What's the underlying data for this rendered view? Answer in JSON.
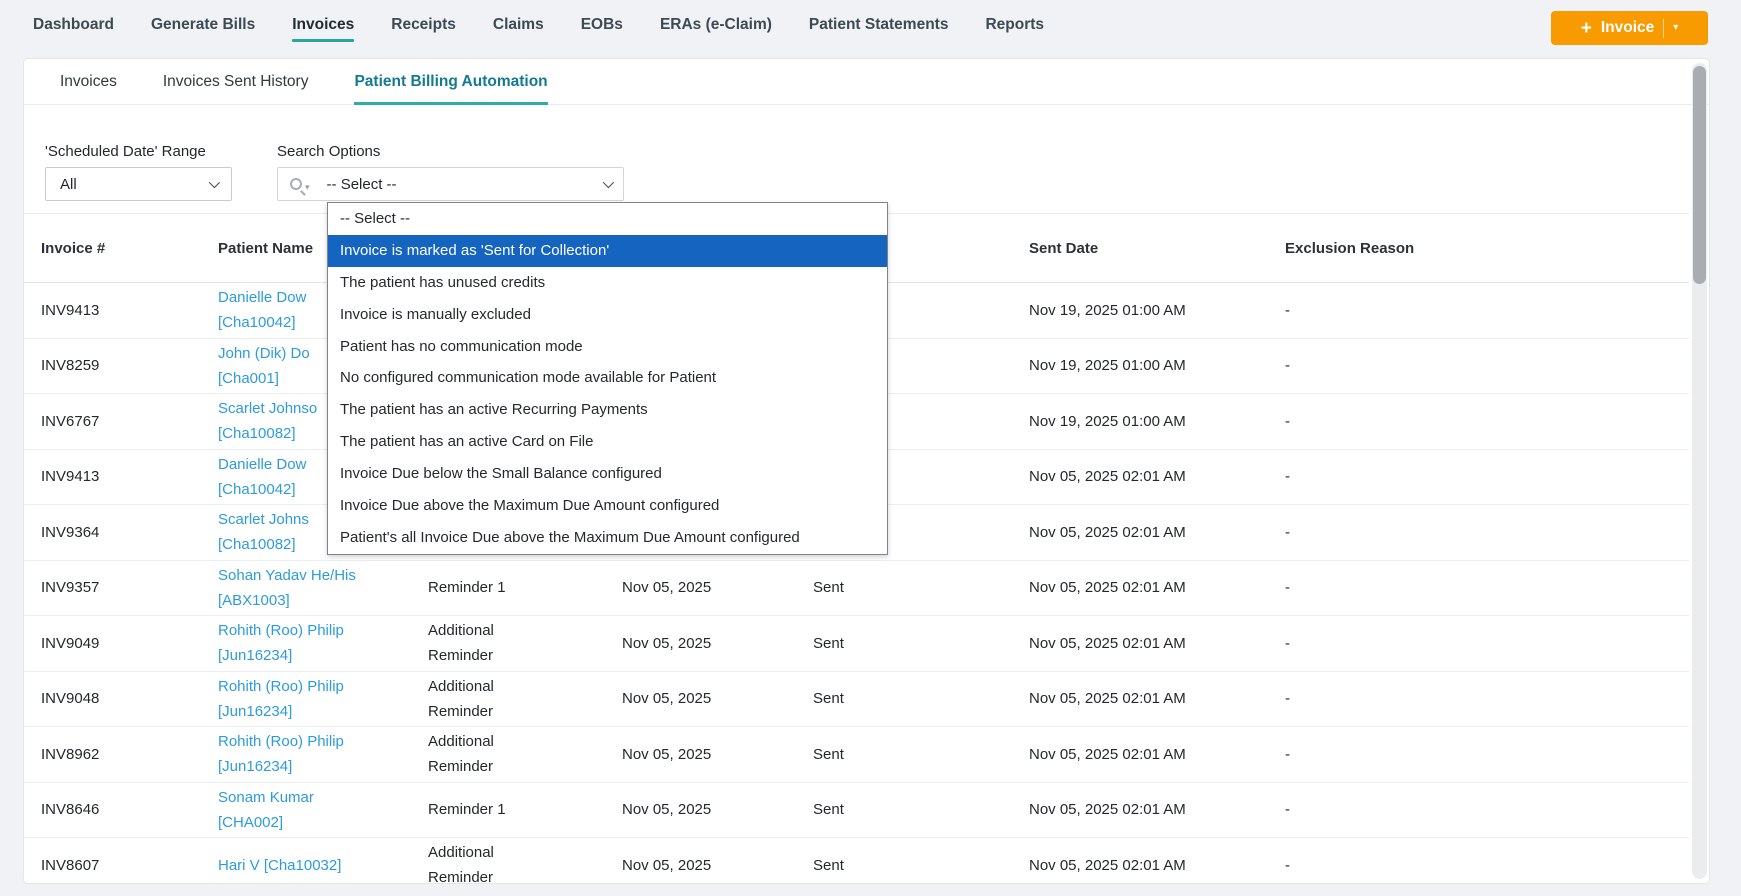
{
  "colors": {
    "accent_teal_underline": "#2aa79b",
    "subtab_active_text": "#137a90",
    "subtab_active_underline": "#2fada4",
    "button_orange": "#f79b00",
    "link_blue": "#2d9cdb",
    "dropdown_highlight_blue": "#1565c0",
    "page_background": "#f0f2f6"
  },
  "topnav": {
    "items": [
      "Dashboard",
      "Generate Bills",
      "Invoices",
      "Receipts",
      "Claims",
      "EOBs",
      "ERAs (e-Claim)",
      "Patient Statements",
      "Reports"
    ],
    "active": "Invoices",
    "invoice_button": {
      "plus": "+",
      "label": "Invoice",
      "caret": "▾"
    }
  },
  "subtabs": {
    "items": [
      "Invoices",
      "Invoices Sent History",
      "Patient Billing Automation"
    ],
    "active": "Patient Billing Automation"
  },
  "filters": {
    "scheduled_range_label": "'Scheduled Date' Range",
    "scheduled_range_value": "All",
    "search_options_label": "Search Options",
    "search_value": "-- Select --"
  },
  "dropdown": {
    "highlighted_index": 1,
    "options": [
      "-- Select --",
      "Invoice is marked as 'Sent for Collection'",
      "The patient has unused credits",
      "Invoice is manually excluded",
      "Patient has no communication mode",
      "No configured communication mode available for Patient",
      "The patient has an active Recurring Payments",
      "The patient has an active Card on File",
      "Invoice Due below the Small Balance configured",
      "Invoice Due above the Maximum Due Amount configured",
      "Patient's all Invoice Due above the Maximum Due Amount configured"
    ]
  },
  "table": {
    "headers": {
      "invoice": "Invoice #",
      "patient": "Patient Name",
      "sent_date": "Sent Date",
      "exclusion": "Exclusion Reason"
    },
    "rows": [
      {
        "invoice": "INV9413",
        "patient1": "Danielle Dow",
        "patient2": "[Cha10042]",
        "type": "",
        "scheduled": "",
        "status": "",
        "sent_date": "Nov 19, 2025 01:00 AM",
        "exclusion": "-"
      },
      {
        "invoice": "INV8259",
        "patient1": "John (Dik) Do",
        "patient2": "[Cha001]",
        "type": "",
        "scheduled": "",
        "status": "",
        "sent_date": "Nov 19, 2025 01:00 AM",
        "exclusion": "-"
      },
      {
        "invoice": "INV6767",
        "patient1": "Scarlet Johnso",
        "patient2": "[Cha10082]",
        "type": "",
        "scheduled": "",
        "status": "",
        "sent_date": "Nov 19, 2025 01:00 AM",
        "exclusion": "-"
      },
      {
        "invoice": "INV9413",
        "patient1": "Danielle Dow",
        "patient2": "[Cha10042]",
        "type": "",
        "scheduled": "",
        "status": "",
        "sent_date": "Nov 05, 2025 02:01 AM",
        "exclusion": "-"
      },
      {
        "invoice": "INV9364",
        "patient1": "Scarlet Johns",
        "patient2": "[Cha10082]",
        "type": "",
        "scheduled": "",
        "status": "",
        "sent_date": "Nov 05, 2025 02:01 AM",
        "exclusion": "-"
      },
      {
        "invoice": "INV9357",
        "patient1": "Sohan Yadav He/His",
        "patient2": "[ABX1003]",
        "type": "Reminder 1",
        "scheduled": "Nov 05, 2025",
        "status": "Sent",
        "sent_date": "Nov 05, 2025 02:01 AM",
        "exclusion": "-"
      },
      {
        "invoice": "INV9049",
        "patient1": "Rohith (Roo) Philip",
        "patient2": "[Jun16234]",
        "type": "Additional Reminder",
        "scheduled": "Nov 05, 2025",
        "status": "Sent",
        "sent_date": "Nov 05, 2025 02:01 AM",
        "exclusion": "-"
      },
      {
        "invoice": "INV9048",
        "patient1": "Rohith (Roo) Philip",
        "patient2": "[Jun16234]",
        "type": "Additional Reminder",
        "scheduled": "Nov 05, 2025",
        "status": "Sent",
        "sent_date": "Nov 05, 2025 02:01 AM",
        "exclusion": "-"
      },
      {
        "invoice": "INV8962",
        "patient1": "Rohith (Roo) Philip",
        "patient2": "[Jun16234]",
        "type": "Additional Reminder",
        "scheduled": "Nov 05, 2025",
        "status": "Sent",
        "sent_date": "Nov 05, 2025 02:01 AM",
        "exclusion": "-"
      },
      {
        "invoice": "INV8646",
        "patient1": "Sonam Kumar",
        "patient2": "[CHA002]",
        "type": "Reminder 1",
        "scheduled": "Nov 05, 2025",
        "status": "Sent",
        "sent_date": "Nov 05, 2025 02:01 AM",
        "exclusion": "-"
      },
      {
        "invoice": "INV8607",
        "patient1": "Hari V [Cha10032]",
        "patient2": "",
        "type": "Additional Reminder",
        "scheduled": "Nov 05, 2025",
        "status": "Sent",
        "sent_date": "Nov 05, 2025 02:01 AM",
        "exclusion": "-"
      }
    ]
  }
}
